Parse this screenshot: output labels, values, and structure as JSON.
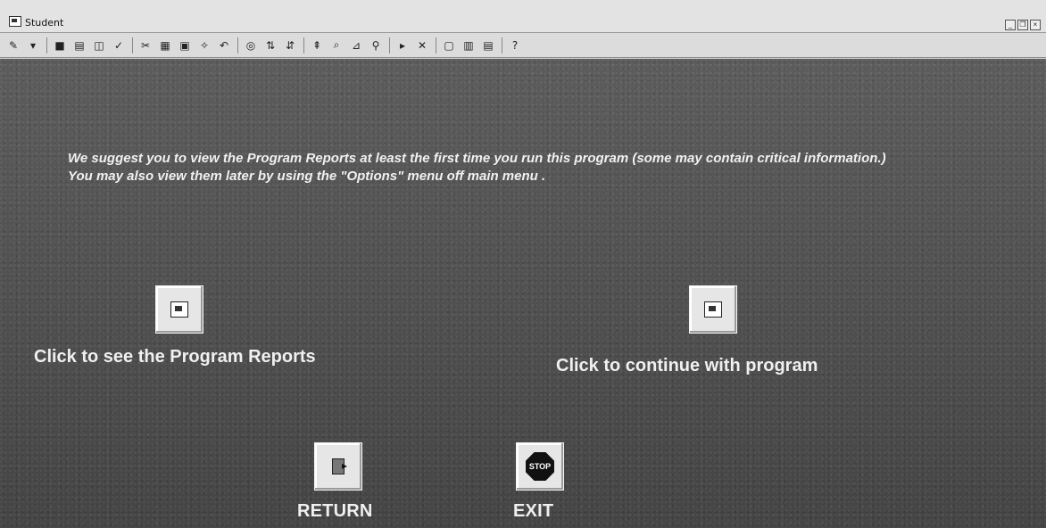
{
  "window": {
    "title": "Student",
    "controls": [
      "_",
      "❐",
      "×"
    ]
  },
  "toolbar": {
    "buttons": [
      "✎",
      "▾",
      "■",
      "▤",
      "◫",
      "✓",
      "✂",
      "▦",
      "▣",
      "✧",
      "↶",
      "◎",
      "⇅",
      "⇵",
      "⇞",
      "⌕",
      "⊿",
      "⚲",
      "▸",
      "✕",
      "▢",
      "▥",
      "▤",
      "?"
    ]
  },
  "message": {
    "text": "We suggest you to view the Program Reports at least the first time you run this program (some may contain critical information.) You may also view them later by using the \"Options\" menu off main menu ."
  },
  "actions": {
    "reports_label": "Click to see the Program Reports",
    "continue_label": "Click to continue with program",
    "return_label": "RETURN",
    "exit_label": "EXIT",
    "stop_text": "STOP"
  }
}
